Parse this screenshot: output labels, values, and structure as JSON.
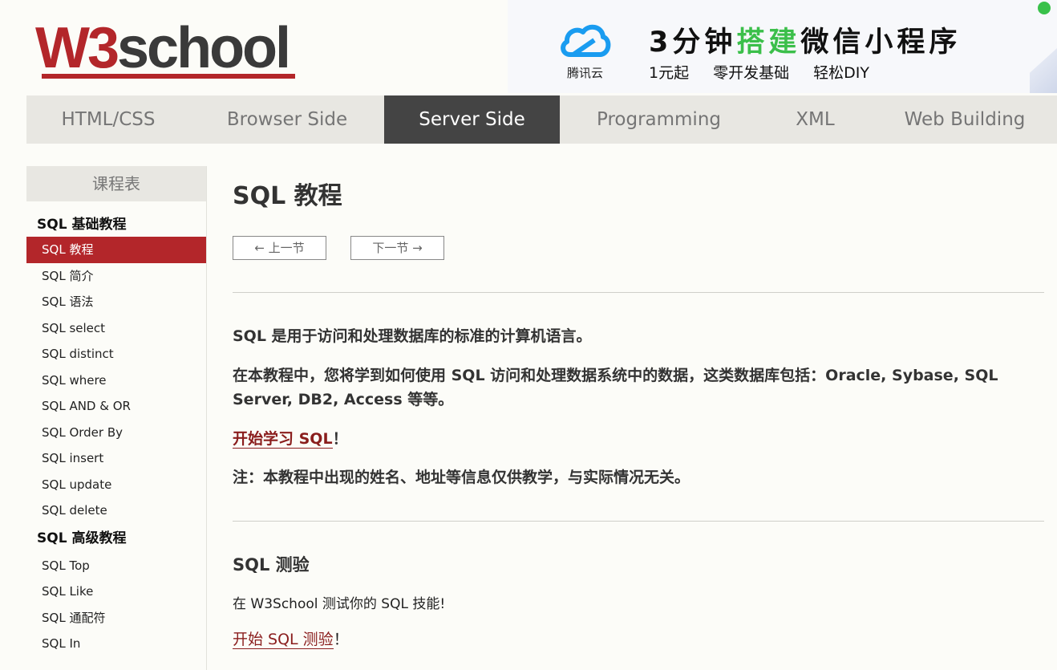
{
  "logo": {
    "w3": "W3",
    "school": "school"
  },
  "ad": {
    "brand": "腾讯云",
    "title_pre": "3分钟",
    "title_hl": "搭建",
    "title_post": "微信小程序",
    "subs": [
      "1元起",
      "零开发基础",
      "轻松DIY"
    ],
    "accent": "#3bbf4a"
  },
  "topnav": {
    "tabs": [
      {
        "label": "HTML/CSS"
      },
      {
        "label": "Browser Side"
      },
      {
        "label": "Server Side"
      },
      {
        "label": "Programming"
      },
      {
        "label": "XML"
      },
      {
        "label": "Web Building"
      }
    ],
    "active": "Server Side"
  },
  "sidebar": {
    "title": "课程表",
    "section_basic": "SQL 基础教程",
    "basic_items": [
      "SQL 教程",
      "SQL 简介",
      "SQL 语法",
      "SQL select",
      "SQL distinct",
      "SQL where",
      "SQL AND & OR",
      "SQL Order By",
      "SQL insert",
      "SQL update",
      "SQL delete"
    ],
    "section_adv": "SQL 高级教程",
    "adv_items": [
      "SQL Top",
      "SQL Like",
      "SQL 通配符",
      "SQL In"
    ],
    "active_item": "SQL 教程"
  },
  "main": {
    "title": "SQL 教程",
    "prev_label": "上一节",
    "next_label": "下一节",
    "p1": "SQL 是用于访问和处理数据库的标准的计算机语言。",
    "p2": "在本教程中，您将学到如何使用 SQL 访问和处理数据系统中的数据，这类数据库包括：Oracle, Sybase, SQL Server, DB2, Access 等等。",
    "start_link": "开始学习 SQL",
    "start_suffix": "！",
    "note": "注：本教程中出现的姓名、地址等信息仅供教学，与实际情况无关。",
    "quiz_title": "SQL 测验",
    "quiz_text": "在 W3School 测试你的 SQL 技能!",
    "quiz_link": "开始 SQL 测验",
    "quiz_suffix": "！"
  },
  "colors": {
    "brand_red": "#b3262a",
    "nav_active": "#444444",
    "link": "#8a1d1d"
  }
}
